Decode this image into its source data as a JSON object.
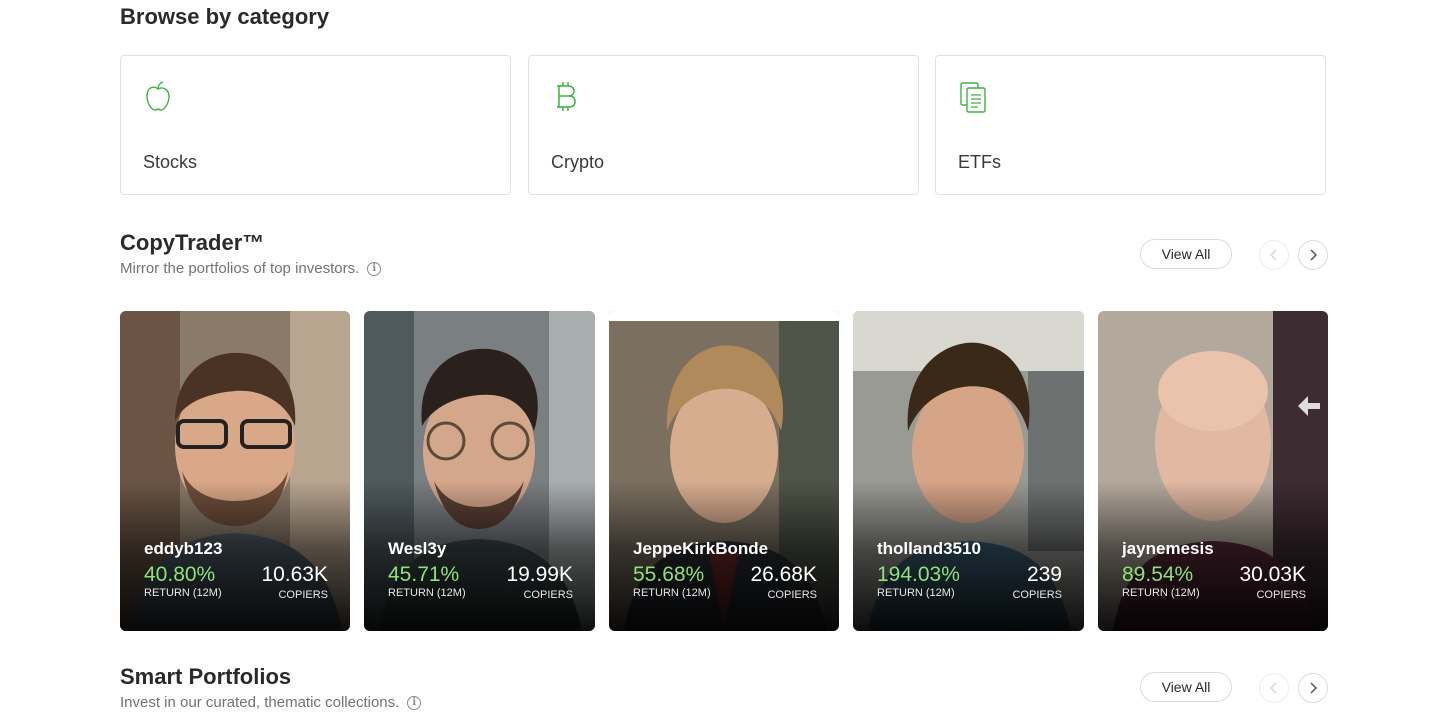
{
  "browse": {
    "title": "Browse by category",
    "categories": [
      {
        "label": "Stocks",
        "icon": "apple-icon"
      },
      {
        "label": "Crypto",
        "icon": "bitcoin-icon"
      },
      {
        "label": "ETFs",
        "icon": "etf-documents-icon"
      }
    ]
  },
  "copytrader": {
    "title": "CopyTrader™",
    "subtitle": "Mirror the portfolios of top investors.",
    "view_all": "View All",
    "traders": [
      {
        "name": "eddyb123",
        "return": "40.80%",
        "return_label": "RETURN (12M)",
        "copiers": "10.63K",
        "copiers_label": "COPIERS"
      },
      {
        "name": "Wesl3y",
        "return": "45.71%",
        "return_label": "RETURN (12M)",
        "copiers": "19.99K",
        "copiers_label": "COPIERS"
      },
      {
        "name": "JeppeKirkBonde",
        "return": "55.68%",
        "return_label": "RETURN (12M)",
        "copiers": "26.68K",
        "copiers_label": "COPIERS"
      },
      {
        "name": "tholland3510",
        "return": "194.03%",
        "return_label": "RETURN (12M)",
        "copiers": "239",
        "copiers_label": "COPIERS"
      },
      {
        "name": "jaynemesis",
        "return": "89.54%",
        "return_label": "RETURN (12M)",
        "copiers": "30.03K",
        "copiers_label": "COPIERS"
      }
    ]
  },
  "smart_portfolios": {
    "title": "Smart Portfolios",
    "subtitle": "Invest in our curated, thematic collections.",
    "view_all": "View All"
  },
  "colors": {
    "accent_green": "#3fb33f",
    "return_green": "#8fe07a"
  }
}
